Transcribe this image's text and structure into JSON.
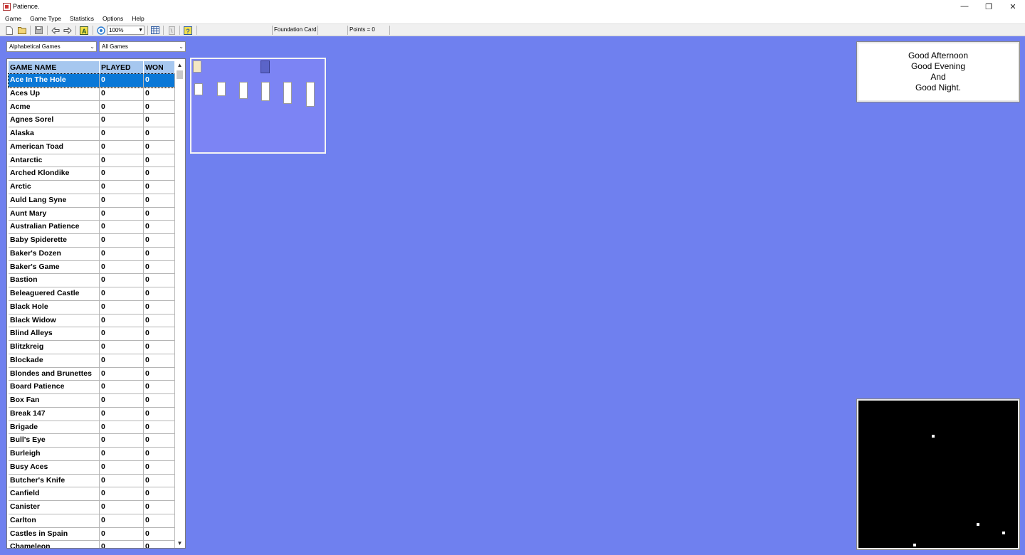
{
  "window": {
    "title": "Patience.",
    "minimize": "—",
    "restore": "❐",
    "close": "✕"
  },
  "menu": [
    "Game",
    "Game Type",
    "Statistics",
    "Options",
    "Help"
  ],
  "toolbar": {
    "zoom": "100%",
    "status_foundation": "Foundation Card",
    "status_points": "Points = 0"
  },
  "filters": {
    "sort": "Alphabetical Games",
    "category": "All Games"
  },
  "table": {
    "headers": {
      "name": "GAME NAME",
      "played": "PLAYED",
      "won": "WON"
    },
    "rows": [
      {
        "name": "Ace In The Hole",
        "played": "0",
        "won": "0"
      },
      {
        "name": "Aces Up",
        "played": "0",
        "won": "0"
      },
      {
        "name": "Acme",
        "played": "0",
        "won": "0"
      },
      {
        "name": "Agnes Sorel",
        "played": "0",
        "won": "0"
      },
      {
        "name": "Alaska",
        "played": "0",
        "won": "0"
      },
      {
        "name": "American Toad",
        "played": "0",
        "won": "0"
      },
      {
        "name": "Antarctic",
        "played": "0",
        "won": "0"
      },
      {
        "name": "Arched Klondike",
        "played": "0",
        "won": "0"
      },
      {
        "name": "Arctic",
        "played": "0",
        "won": "0"
      },
      {
        "name": "Auld Lang Syne",
        "played": "0",
        "won": "0"
      },
      {
        "name": "Aunt Mary",
        "played": "0",
        "won": "0"
      },
      {
        "name": "Australian Patience",
        "played": "0",
        "won": "0"
      },
      {
        "name": "Baby Spiderette",
        "played": "0",
        "won": "0"
      },
      {
        "name": "Baker's Dozen",
        "played": "0",
        "won": "0"
      },
      {
        "name": "Baker's Game",
        "played": "0",
        "won": "0"
      },
      {
        "name": "Bastion",
        "played": "0",
        "won": "0"
      },
      {
        "name": "Beleaguered Castle",
        "played": "0",
        "won": "0"
      },
      {
        "name": "Black Hole",
        "played": "0",
        "won": "0"
      },
      {
        "name": "Black Widow",
        "played": "0",
        "won": "0"
      },
      {
        "name": "Blind Alleys",
        "played": "0",
        "won": "0"
      },
      {
        "name": "Blitzkreig",
        "played": "0",
        "won": "0"
      },
      {
        "name": "Blockade",
        "played": "0",
        "won": "0"
      },
      {
        "name": "Blondes and Brunettes",
        "played": "0",
        "won": "0"
      },
      {
        "name": "Board Patience",
        "played": "0",
        "won": "0"
      },
      {
        "name": "Box Fan",
        "played": "0",
        "won": "0"
      },
      {
        "name": "Break 147",
        "played": "0",
        "won": "0"
      },
      {
        "name": "Brigade",
        "played": "0",
        "won": "0"
      },
      {
        "name": "Bull's Eye",
        "played": "0",
        "won": "0"
      },
      {
        "name": "Burleigh",
        "played": "0",
        "won": "0"
      },
      {
        "name": "Busy Aces",
        "played": "0",
        "won": "0"
      },
      {
        "name": "Butcher's Knife",
        "played": "0",
        "won": "0"
      },
      {
        "name": "Canfield",
        "played": "0",
        "won": "0"
      },
      {
        "name": "Canister",
        "played": "0",
        "won": "0"
      },
      {
        "name": "Carlton",
        "played": "0",
        "won": "0"
      },
      {
        "name": "Castles in Spain",
        "played": "0",
        "won": "0"
      },
      {
        "name": "Chameleon",
        "played": "0",
        "won": "0"
      }
    ]
  },
  "message": [
    "Good Afternoon",
    "Good Evening",
    "And",
    "Good Night."
  ],
  "colors": {
    "background": "#6f80ef",
    "selection": "#0a78d7",
    "header": "#a6c7ef"
  }
}
